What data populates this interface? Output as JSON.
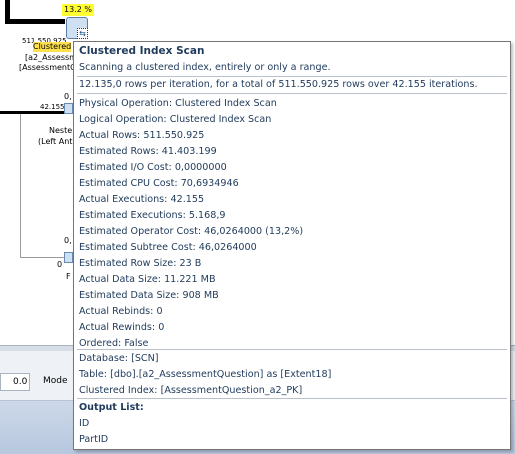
{
  "plan": {
    "cost_percent": "13.2 %",
    "rows_label": "511.550.925",
    "node_name": "Clustered",
    "node_table": "[a2_Assessm",
    "node_index": "[AssessmentQ",
    "link_count": "42.155",
    "nested_label": "Neste",
    "nested_sub": "(Left Ant",
    "zero_a": "0,",
    "zero_b": "0,",
    "zero_c": "0",
    "letter_f": "F"
  },
  "statusbar": {
    "zoom_value": "0.0",
    "mode_label": "Mode"
  },
  "tooltip": {
    "title": "Clustered Index Scan",
    "description": "Scanning a clustered index, entirely or only a range.",
    "summary": "12.135,0 rows per iteration, for a total of 511.550.925 rows over 42.155 iterations.",
    "properties": [
      {
        "label": "Physical Operation:",
        "value": "Clustered Index Scan"
      },
      {
        "label": "Logical Operation:",
        "value": "Clustered Index Scan"
      },
      {
        "label": "Actual Rows:",
        "value": "511.550.925"
      },
      {
        "label": "Estimated Rows:",
        "value": "41.403.199"
      },
      {
        "label": "Estimated I/O Cost:",
        "value": "0,0000000"
      },
      {
        "label": "Estimated CPU Cost:",
        "value": "70,6934946"
      },
      {
        "label": "Actual Executions:",
        "value": "42.155"
      },
      {
        "label": "Estimated Executions:",
        "value": "5.168,9"
      },
      {
        "label": "Estimated Operator Cost:",
        "value": "46,0264000 (13,2%)"
      },
      {
        "label": "Estimated Subtree Cost:",
        "value": "46,0264000"
      },
      {
        "label": "Estimated Row Size:",
        "value": "23 B"
      },
      {
        "label": "Actual Data Size:",
        "value": "11.221 MB"
      },
      {
        "label": "Estimated Data Size:",
        "value": "908 MB"
      },
      {
        "label": "Actual Rebinds:",
        "value": "0"
      },
      {
        "label": "Actual Rewinds:",
        "value": "0"
      },
      {
        "label": "Ordered:",
        "value": "False"
      }
    ],
    "objects": [
      {
        "label": "Database:",
        "value": "[SCN]"
      },
      {
        "label": "Table:",
        "value": "[dbo].[a2_AssessmentQuestion] as [Extent18]"
      },
      {
        "label": "Clustered Index:",
        "value": "[AssessmentQuestion_a2_PK]"
      }
    ],
    "output_title": "Output List:",
    "output_columns": [
      "ID",
      "PartID"
    ]
  }
}
